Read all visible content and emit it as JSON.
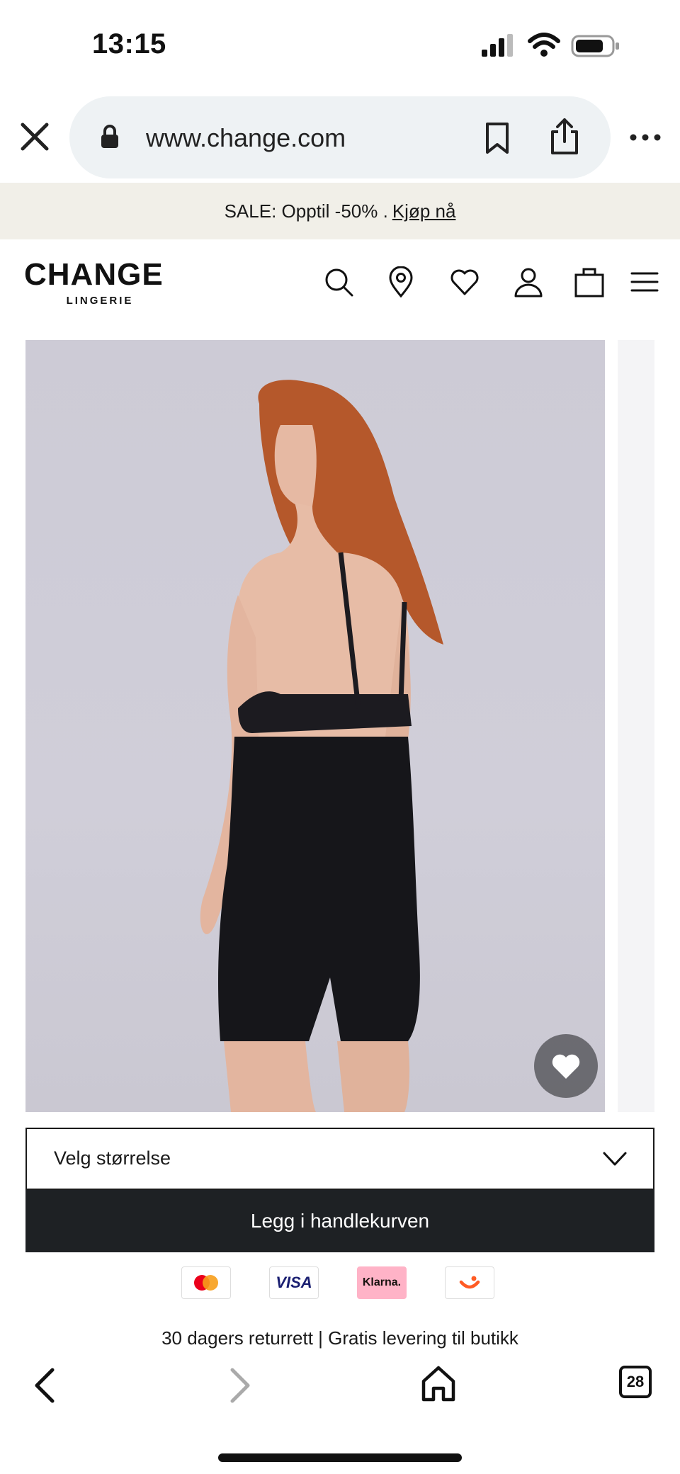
{
  "status": {
    "time": "13:15"
  },
  "browser": {
    "url": "www.change.com",
    "tab_count": "28"
  },
  "promo": {
    "text": "SALE: Opptil -50% .",
    "link": "Kjøp nå"
  },
  "header": {
    "logo_main": "CHANGE",
    "logo_sub": "LINGERIE",
    "icons": [
      "search-icon",
      "store-locator-icon",
      "heart-icon",
      "account-icon",
      "bag-icon",
      "menu-icon"
    ]
  },
  "product": {
    "size_placeholder": "Velg størrelse",
    "add_to_cart": "Legg i handlekurven"
  },
  "payments": {
    "visa": "VISA",
    "klarna": "Klarna."
  },
  "usp": "30 dagers returrett | Gratis levering til butikk",
  "colors": {
    "banner_bg": "#f1efe8",
    "cart_button": "#1e2124",
    "url_pill": "#eef2f4"
  }
}
